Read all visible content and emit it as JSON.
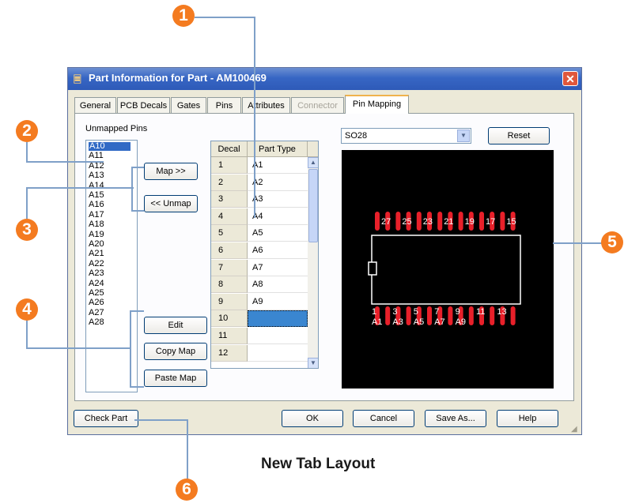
{
  "dialog": {
    "title": "Part Information for Part - AM100469",
    "close_icon": "close-icon",
    "app_icon": "part-info-icon"
  },
  "tabs": [
    {
      "label": "General",
      "state": "normal"
    },
    {
      "label": "PCB Decals",
      "state": "normal"
    },
    {
      "label": "Gates",
      "state": "normal"
    },
    {
      "label": "Pins",
      "state": "normal"
    },
    {
      "label": "Attributes",
      "state": "normal"
    },
    {
      "label": "Connector",
      "state": "disabled"
    },
    {
      "label": "Pin Mapping",
      "state": "active"
    }
  ],
  "unmapped": {
    "label": "Unmapped Pins",
    "pins": [
      "A10",
      "A11",
      "A12",
      "A13",
      "A14",
      "A15",
      "A16",
      "A17",
      "A18",
      "A19",
      "A20",
      "A21",
      "A22",
      "A23",
      "A24",
      "A25",
      "A26",
      "A27",
      "A28"
    ],
    "selected": "A10"
  },
  "buttons": {
    "map": "Map >>",
    "unmap": "<< Unmap",
    "edit": "Edit",
    "copy_map": "Copy Map",
    "paste_map": "Paste Map",
    "reset": "Reset",
    "check_part": "Check Part",
    "ok": "OK",
    "cancel": "Cancel",
    "save_as": "Save As...",
    "help": "Help"
  },
  "grid": {
    "headers": [
      "Decal",
      "Part Type"
    ],
    "rows": [
      {
        "decal": "1",
        "type": "A1"
      },
      {
        "decal": "2",
        "type": "A2"
      },
      {
        "decal": "3",
        "type": "A3"
      },
      {
        "decal": "4",
        "type": "A4"
      },
      {
        "decal": "5",
        "type": "A5"
      },
      {
        "decal": "6",
        "type": "A6"
      },
      {
        "decal": "7",
        "type": "A7"
      },
      {
        "decal": "8",
        "type": "A8"
      },
      {
        "decal": "9",
        "type": "A9"
      },
      {
        "decal": "10",
        "type": ""
      },
      {
        "decal": "11",
        "type": ""
      },
      {
        "decal": "12",
        "type": ""
      }
    ],
    "selected_row": "10"
  },
  "decal_select": {
    "value": "SO28"
  },
  "preview": {
    "top_pin_numbers": [
      "27",
      "25",
      "23",
      "21",
      "19",
      "17",
      "15"
    ],
    "bottom_pin_numbers": [
      "1",
      "3",
      "5",
      "7",
      "9",
      "11",
      "13"
    ],
    "bottom_pin_names": [
      "A1",
      "A3",
      "A5",
      "A7",
      "A9"
    ],
    "pad_color": "#e8202a",
    "outline_color": "#ffffff",
    "background": "#000000"
  },
  "callouts": [
    "1",
    "2",
    "3",
    "4",
    "5",
    "6"
  ],
  "callout_color": "#f47b20",
  "caption": "New Tab Layout"
}
